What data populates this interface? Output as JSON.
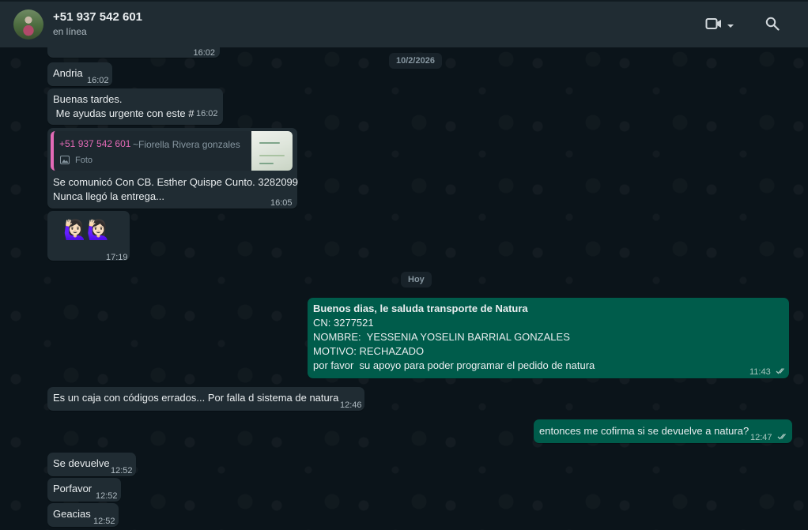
{
  "header": {
    "contact_name": "+51 937 542 601",
    "status": "en línea"
  },
  "messages": [
    {
      "time": "16:02"
    },
    {
      "author": "Andria",
      "time": "16:02"
    },
    {
      "line1": "Buenas tardes.",
      "line2": " Me ayudas urgente con este #",
      "time": "16:02"
    },
    {
      "quote_author": "+51 937 542 601",
      "quote_pushname": "~Fiorella Rivera gonzales",
      "quote_type": "Foto",
      "line1": "Se comunicó Con CB. Esther Quispe Cunto. 3282099",
      "line2": "Nunca llegó la entrega...",
      "time": "16:05"
    },
    {
      "emoji": "🙋🏻‍♀️🙋🏻‍♀️",
      "time": "17:19"
    },
    {
      "line1": "Buenos dias, le saluda transporte de Natura",
      "line2": "CN: 3277521",
      "line3": "NOMBRE:  YESSENIA YOSELIN BARRIAL GONZALES",
      "line4": "MOTIVO: RECHAZADO",
      "line5": "por favor  su apoyo para poder programar el pedido de natura",
      "time": "11:43"
    },
    {
      "text": "Es un caja con códigos errados... Por falla d sistema de natura",
      "time": "12:46"
    },
    {
      "text": "entonces me cofirma si se devuelve a natura?",
      "time": "12:47"
    },
    {
      "text": "Se devuelve",
      "time": "12:52"
    },
    {
      "text": "Porfavor",
      "time": "12:52"
    },
    {
      "text": "Geacias",
      "time": "12:52"
    }
  ],
  "date_dividers": {
    "first": "10/2/2026",
    "second": "Hoy"
  },
  "colors": {
    "header_bg": "#202c33",
    "chat_bg": "#0b141a",
    "incoming_bubble": "#202c33",
    "outgoing_bubble": "#005c4b",
    "quote_accent": "#e26ab6",
    "read_ticks": "#a8c7bf"
  },
  "icons": [
    "video-call-icon",
    "chevron-down-icon",
    "search-icon",
    "photo-icon",
    "double-check-icon"
  ]
}
